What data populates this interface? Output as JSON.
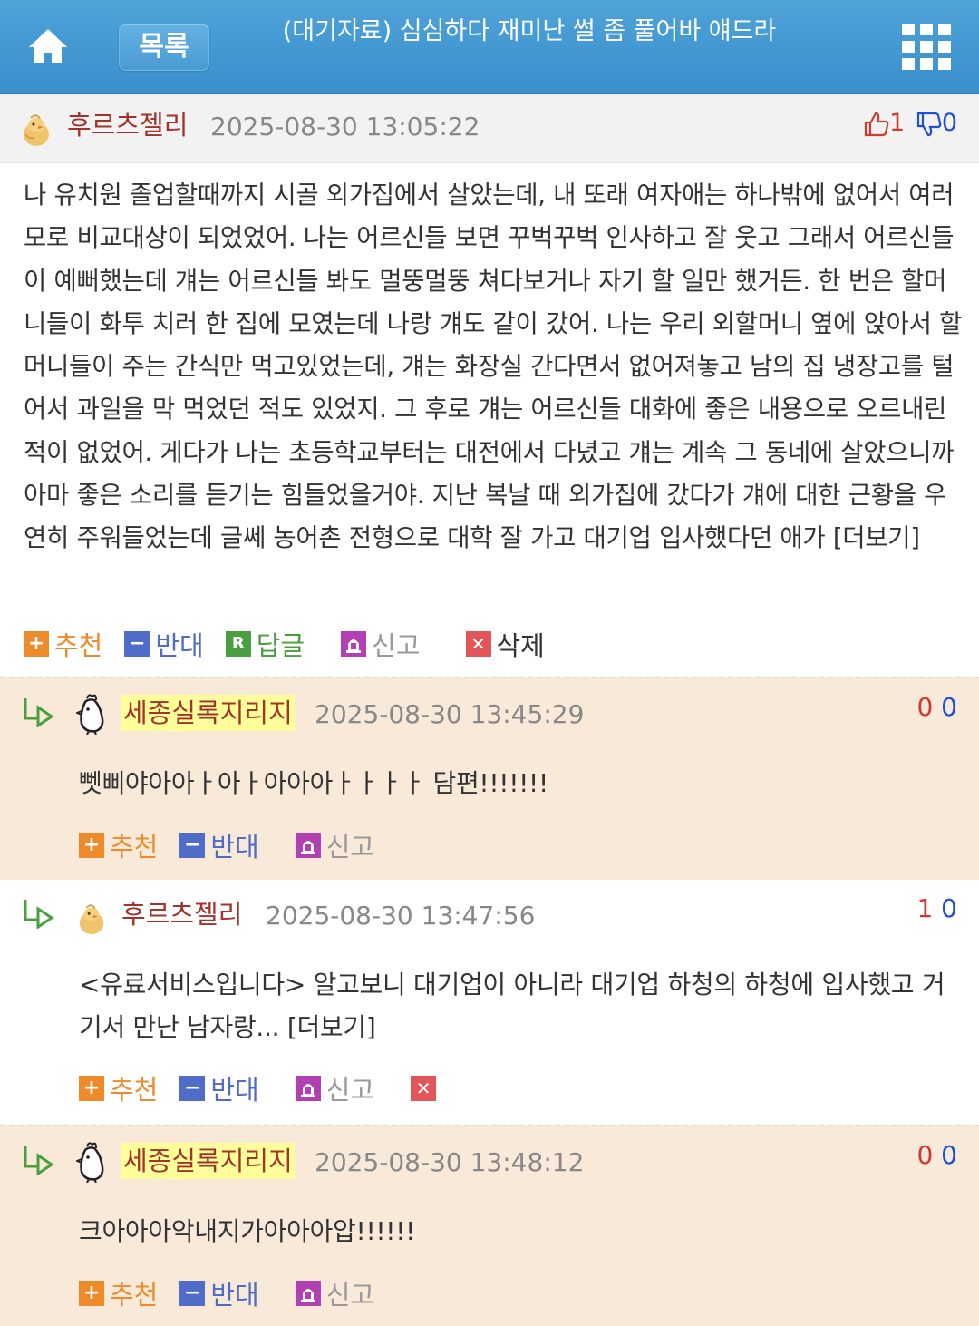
{
  "header": {
    "home_icon": "home-icon",
    "list_label": "목록",
    "title": "(대기자료) 심심하다 재미난 썰 좀 풀어바 얘드라",
    "menu_icon": "grid-menu-icon",
    "colors": {
      "bar": "#4fa3d9"
    }
  },
  "post": {
    "author": "후르츠젤리",
    "date": "2025-08-30 13:05:22",
    "upvotes": "1",
    "downvotes": "0",
    "body": "나 유치원 졸업할때까지 시골 외가집에서 살았는데, 내 또래 여자애는 하나밖에 없어서 여러모로 비교대상이 되었었어. 나는 어르신들 보면 꾸벅꾸벅 인사하고 잘 웃고 그래서 어르신들이 예뻐했는데 걔는 어르신들 봐도 멀뚱멀뚱 쳐다보거나 자기 할 일만 했거든. 한 번은 할머니들이 화투 치러 한 집에 모였는데 나랑 걔도 같이 갔어. 나는 우리 외할머니 옆에 앉아서 할머니들이 주는 간식만 먹고있었는데, 걔는 화장실 간다면서 없어져놓고 남의 집 냉장고를 털어서 과일을 막 먹었던 적도 있었지. 그 후로 걔는 어르신들 대화에 좋은 내용으로 오르내린 적이 없었어. 게다가 나는 초등학교부터는 대전에서 다녔고 걔는 계속 그 동네에 살았으니까 아마 좋은 소리를 듣기는 힘들었을거야. 지난 복날 때 외가집에 갔다가 걔에 대한 근황을 우연히 주워들었는데 글쎄 농어촌 전형으로 대학 잘 가고 대기업 입사했다던 애가 [더보기]",
    "actions": {
      "recommend": "추천",
      "oppose": "반대",
      "reply": "답글",
      "report": "신고",
      "delete": "삭제"
    }
  },
  "comments": [
    {
      "author": "세종실록지리지",
      "date": "2025-08-30 13:45:29",
      "up": "0",
      "down": "0",
      "body": "뻿삐야아아ㅏ아ㅏ아아아ㅏㅏㅏㅏ 담편!!!!!!!",
      "recommend": "추천",
      "oppose": "반대",
      "report": "신고"
    },
    {
      "author": "후르츠젤리",
      "date": "2025-08-30 13:47:56",
      "up": "1",
      "down": "0",
      "body": "<유료서비스입니다> 알고보니 대기업이 아니라 대기업 하청의 하청에 입사했고 거기서 만난 남자랑... [더보기]",
      "recommend": "추천",
      "oppose": "반대",
      "report": "신고"
    },
    {
      "author": "세종실록지리지",
      "date": "2025-08-30 13:48:12",
      "up": "0",
      "down": "0",
      "body": "크아아아악내지가아아아압!!!!!!",
      "recommend": "추천",
      "oppose": "반대",
      "report": "신고"
    }
  ],
  "colors": {
    "author": "#a3322b",
    "upvote": "#d03a32",
    "downvote": "#1f4fd6",
    "recommend": "#ef8a2a",
    "oppose": "#4f6cc8",
    "reply": "#4aa041",
    "report": "#b23fb3",
    "comment_bg": "#f8e9d8",
    "highlight": "#ffff99"
  }
}
